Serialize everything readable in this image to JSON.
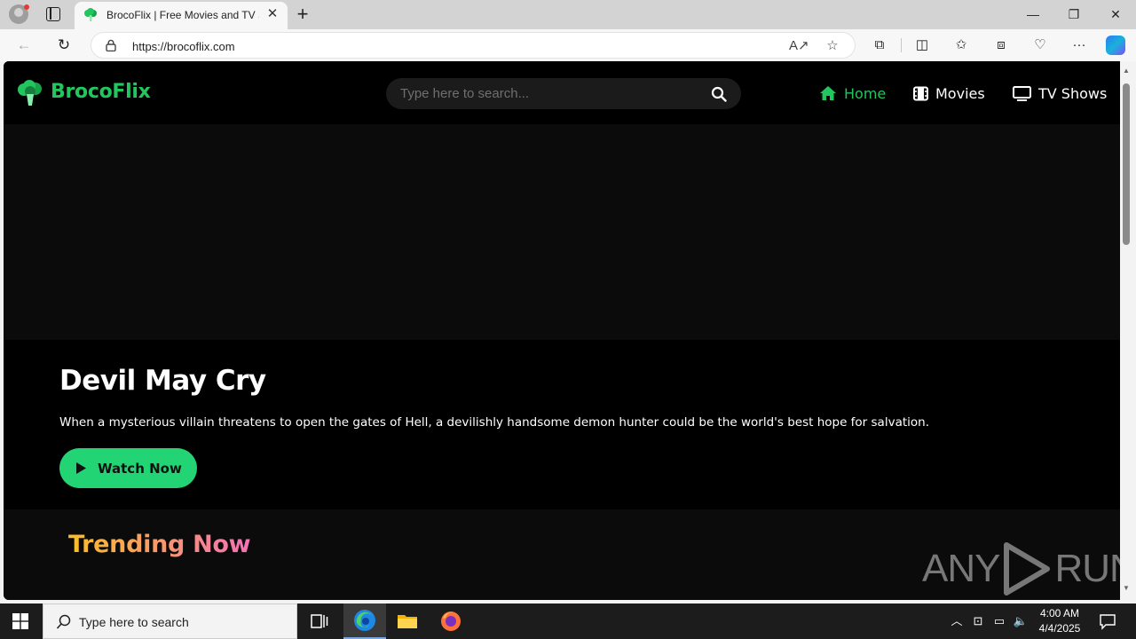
{
  "browser": {
    "tab_title": "BrocoFlix | Free Movies and TV Shows",
    "tab_close": "✕",
    "new_tab": "+",
    "url": "https://brocoflix.com",
    "window_controls": {
      "minimize": "—",
      "restore": "❐",
      "close": "✕"
    }
  },
  "site": {
    "brand": "BrocoFlix",
    "search_placeholder": "Type here to search...",
    "nav": [
      {
        "label": "Home",
        "icon": "home-icon",
        "active": true
      },
      {
        "label": "Movies",
        "icon": "film-icon",
        "active": false
      },
      {
        "label": "TV Shows",
        "icon": "tv-icon",
        "active": false
      }
    ],
    "hero": {
      "title": "Devil May Cry",
      "description": "When a mysterious villain threatens to open the gates of Hell, a devilishly handsome demon hunter could be the world's best hope for salvation.",
      "button": "Watch Now"
    },
    "trending_title": "Trending Now"
  },
  "watermark": {
    "left": "ANY",
    "right": "RUN"
  },
  "taskbar": {
    "search_placeholder": "Type here to search",
    "time": "4:00 AM",
    "date": "4/4/2025"
  },
  "colors": {
    "brand_green": "#22c55e",
    "button_green": "#22d474",
    "trending_gradient_start": "#fbbf24",
    "trending_gradient_end": "#f472b6"
  }
}
